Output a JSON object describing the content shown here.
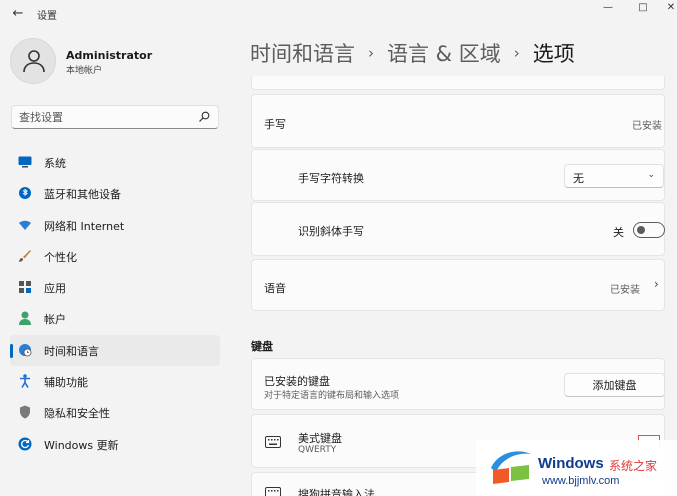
{
  "window": {
    "title": "设置",
    "back_glyph": "←",
    "min_glyph": "—",
    "max_glyph": "□",
    "close_glyph": "✕"
  },
  "profile": {
    "name": "Administrator",
    "account_type": "本地帐户"
  },
  "search": {
    "placeholder": "查找设置",
    "icon": "search-icon"
  },
  "sidebar": {
    "items": [
      {
        "label": "系统",
        "icon": "monitor-icon",
        "active": false
      },
      {
        "label": "蓝牙和其他设备",
        "icon": "bluetooth-icon",
        "active": false
      },
      {
        "label": "网络和 Internet",
        "icon": "wifi-icon",
        "active": false
      },
      {
        "label": "个性化",
        "icon": "brush-icon",
        "active": false
      },
      {
        "label": "应用",
        "icon": "apps-icon",
        "active": false
      },
      {
        "label": "帐户",
        "icon": "person-icon",
        "active": false
      },
      {
        "label": "时间和语言",
        "icon": "globe-clock-icon",
        "active": true
      },
      {
        "label": "辅助功能",
        "icon": "accessibility-icon",
        "active": false
      },
      {
        "label": "隐私和安全性",
        "icon": "shield-icon",
        "active": false
      },
      {
        "label": "Windows 更新",
        "icon": "update-icon",
        "active": false
      }
    ]
  },
  "breadcrumb": {
    "level1": "时间和语言",
    "level2": "语言 & 区域",
    "current": "选项",
    "separator": "›"
  },
  "handwriting": {
    "label": "手写",
    "status": "已安装",
    "conversion_label": "手写字符转换",
    "conversion_value": "无",
    "chevron": "⌄",
    "italic_label": "识别斜体手写",
    "italic_state": "关"
  },
  "speech": {
    "label": "语音",
    "status": "已安装",
    "chevron": "›"
  },
  "keyboard": {
    "section_title": "键盘",
    "installed_label": "已安装的键盘",
    "installed_desc": "对于特定语言的键布局和输入选项",
    "add_button": "添加键盘",
    "items": [
      {
        "name": "美式键盘",
        "sub": "QWERTY"
      },
      {
        "name": "搜狗拼音输入法",
        "sub": ""
      }
    ]
  },
  "watermark": {
    "brand": "Windows",
    "tagline": "系统之家",
    "url": "www.bjjmlv.com"
  },
  "colors": {
    "accent": "#0067c0",
    "background": "#f3f3f3",
    "card": "#fbfbfb"
  }
}
